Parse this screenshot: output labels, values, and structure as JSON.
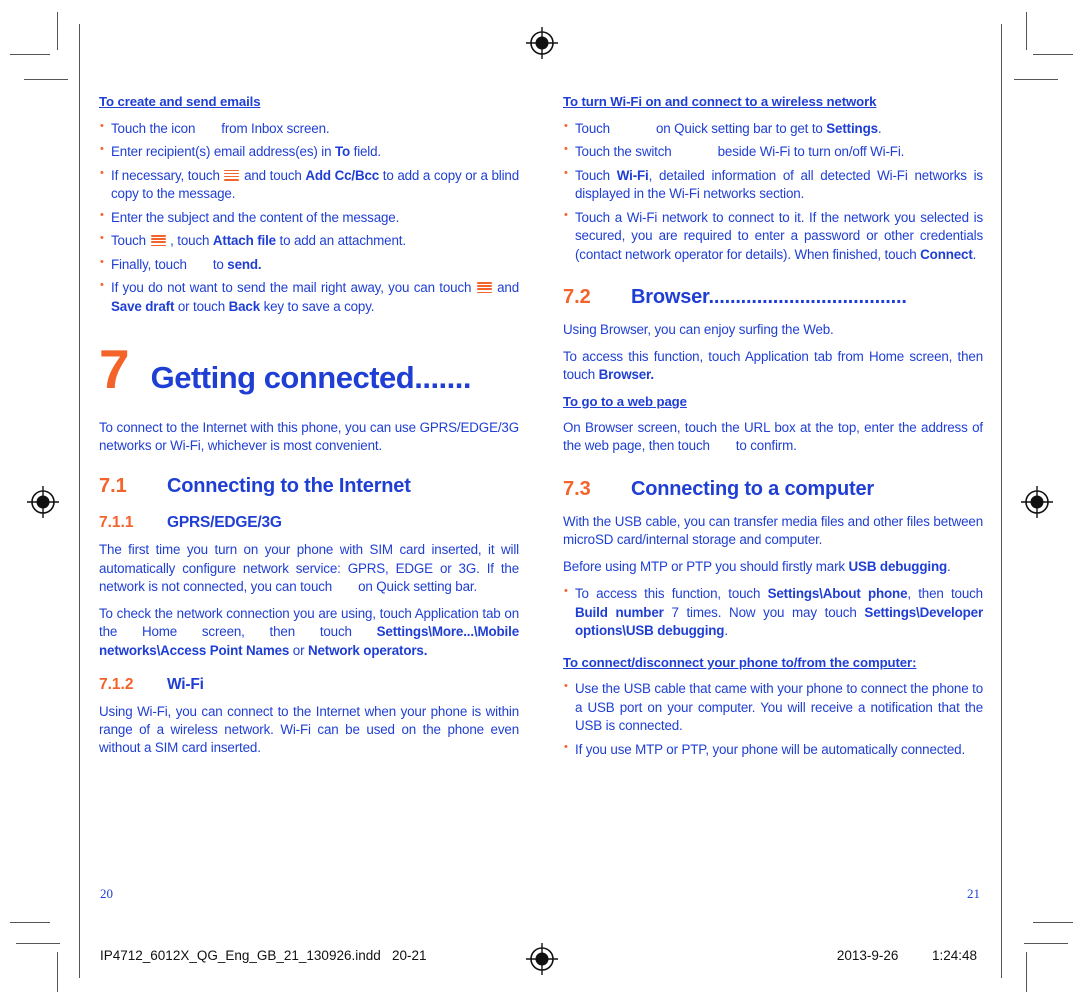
{
  "meta": {
    "colors": {
      "blue": "#1f3fd4",
      "orange": "#f4632a",
      "crop_mark": "#555555"
    }
  },
  "left_page": {
    "folio": "20",
    "sections": [
      {
        "type": "sub-head",
        "text": "To create and send emails"
      },
      {
        "type": "bullets",
        "items": [
          "Touch the icon       from Inbox screen.",
          "Enter recipient(s) email address(es) in To field.",
          "If necessary, touch [menu] and touch Add Cc/Bcc to add a copy or a blind copy to the message.",
          "Enter the subject and the content of the message.",
          "Touch [menu] , touch Attach file to add an attachment.",
          "Finally, touch       to send.",
          "If you do not want to send the mail right away, you can touch [menu] and Save draft or touch Back key to save a copy."
        ]
      }
    ],
    "chapter": {
      "number": "7",
      "title": "Getting connected......."
    },
    "intro": "To connect to the Internet with this phone, you can use GPRS/EDGE/3G networks or Wi-Fi, whichever is most convenient.",
    "section_71": {
      "number": "7.1",
      "title": "Connecting to the Internet"
    },
    "section_711": {
      "number": "7.1.1",
      "title": "GPRS/EDGE/3G"
    },
    "p_711_a": "The first time you turn on your phone with SIM card inserted, it will automatically configure network service: GPRS, EDGE or 3G. If the network is not connected, you can touch        on Quick setting bar.",
    "p_711_b_pre": "To check the network connection you are using, touch Application tab on the Home screen, then touch ",
    "p_711_b_b1": "Settings\\More...\\Mobile networks\\Access Point Names",
    "p_711_b_mid": " or ",
    "p_711_b_b2": "Network operators.",
    "section_712": {
      "number": "7.1.2",
      "title": "Wi-Fi"
    },
    "p_712": "Using Wi-Fi, you can connect to the Internet when your phone is within range of a wireless network. Wi-Fi can be used on the phone even without a SIM card inserted."
  },
  "right_page": {
    "folio": "21",
    "sub_head_wifi": "To turn Wi-Fi on and connect to a wireless network",
    "wifi_bullets": [
      {
        "parts": [
          {
            "t": "Touch",
            "b": false
          },
          {
            "t": "ICONSLOT_WIDE",
            "b": false
          },
          {
            "t": "on Quick setting bar to get to ",
            "b": false
          },
          {
            "t": "Settings",
            "b": true
          },
          {
            "t": ".",
            "b": false
          }
        ]
      },
      {
        "parts": [
          {
            "t": "Touch the switch",
            "b": false
          },
          {
            "t": "ICONSLOT_WIDE",
            "b": false
          },
          {
            "t": "beside Wi-Fi to  turn on/off Wi-Fi.",
            "b": false
          }
        ]
      },
      {
        "parts": [
          {
            "t": "Touch ",
            "b": false
          },
          {
            "t": "Wi-Fi",
            "b": true
          },
          {
            "t": ", detailed information of all detected Wi-Fi networks is displayed in the Wi-Fi networks section.",
            "b": false
          }
        ]
      },
      {
        "parts": [
          {
            "t": "Touch a Wi-Fi network to connect to it. If the network you selected is secured, you are required to enter a password or other credentials (contact network operator for details). When finished, touch ",
            "b": false
          },
          {
            "t": "Connect",
            "b": true
          },
          {
            "t": ".",
            "b": false
          }
        ]
      }
    ],
    "section_72": {
      "number": "7.2",
      "title": "Browser",
      "dots": "....................................."
    },
    "p_72_a": "Using Browser, you can enjoy surfing the Web.",
    "p_72_b_pre": "To access this function, touch Application tab from Home screen, then touch ",
    "p_72_b_bold": "Browser.",
    "sub_head_webpage": "To go to a web page",
    "p_72_c": "On Browser screen, touch the URL box at the top, enter the address of the web page, then touch       to confirm.",
    "section_73": {
      "number": "7.3",
      "title": "Connecting to a computer"
    },
    "p_73_a": "With the USB cable, you can transfer media files and other files between microSD card/internal storage and computer.",
    "p_73_b_pre": "Before using MTP or PTP you should firstly mark ",
    "p_73_b_bold": "USB debugging",
    "p_73_b_post": ".",
    "bullet_73": {
      "parts": [
        {
          "t": "To access this function, touch ",
          "b": false
        },
        {
          "t": "Settings\\About phone",
          "b": true
        },
        {
          "t": ", then touch ",
          "b": false
        },
        {
          "t": "Build number",
          "b": true
        },
        {
          "t": " 7 times. Now you may touch ",
          "b": false
        },
        {
          "t": "Settings\\Developer options\\USB debugging",
          "b": true
        },
        {
          "t": ".",
          "b": false
        }
      ]
    },
    "sub_head_connect": "To connect/disconnect your phone to/from the computer:",
    "connect_bullets": [
      "Use the USB cable that came with your phone to connect the phone to a USB port on your computer. You will receive a notification that the USB is connected.",
      "If you use MTP or PTP, your phone will be automatically connected."
    ]
  },
  "footer": {
    "filename": "IP4712_6012X_QG_Eng_GB_21_130926.indd",
    "pages": "20-21",
    "date": "2013-9-26",
    "time": "1:24:48"
  }
}
